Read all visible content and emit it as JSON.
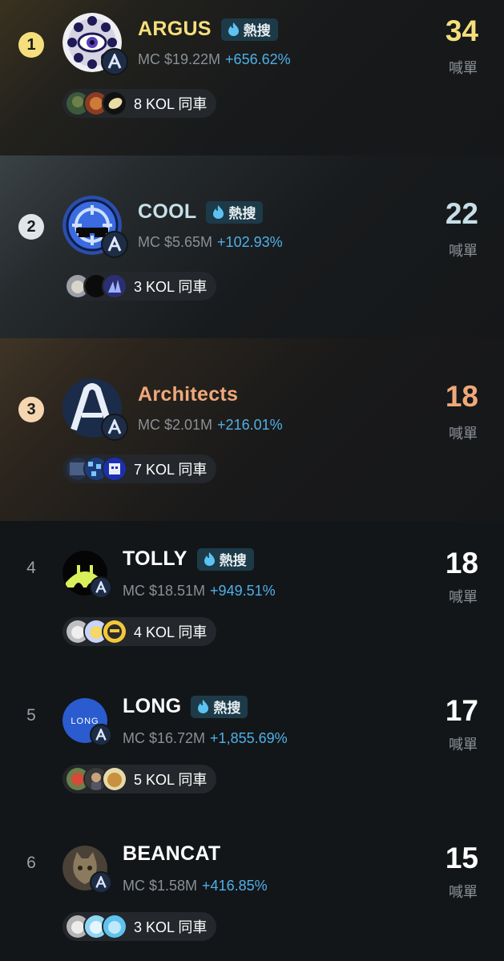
{
  "colors": {
    "gold": "#f5df7c",
    "silver": "#c6dfe7",
    "bronze": "#f0a87a",
    "white": "#ffffff",
    "percent": "#4fb0e8",
    "hot_badge_bg": "#1d3a48"
  },
  "hot_label": "熱搜",
  "count_label": "喊單",
  "rows": [
    {
      "rank": "1",
      "name": "ARGUS",
      "hot": true,
      "mc": "MC $19.22M",
      "pct": "+656.62%",
      "kol": "8 KOL 同車",
      "count": "34",
      "icon": "eye-sphere-icon"
    },
    {
      "rank": "2",
      "name": "COOL",
      "hot": true,
      "mc": "MC $5.65M",
      "pct": "+102.93%",
      "kol": "3 KOL 同車",
      "count": "22",
      "icon": "target-sunglasses-icon"
    },
    {
      "rank": "3",
      "name": "Architects",
      "hot": false,
      "mc": "MC $2.01M",
      "pct": "+216.01%",
      "kol": "7 KOL 同車",
      "count": "18",
      "icon": "arch-a-icon"
    },
    {
      "rank": "4",
      "name": "TOLLY",
      "hot": true,
      "mc": "MC $18.51M",
      "pct": "+949.51%",
      "kol": "4 KOL 同車",
      "count": "18",
      "icon": "bridge-icon"
    },
    {
      "rank": "5",
      "name": "LONG",
      "hot": true,
      "mc": "MC $16.72M",
      "pct": "+1,855.69%",
      "kol": "5 KOL 同車",
      "count": "17",
      "icon": "long-logo-icon"
    },
    {
      "rank": "6",
      "name": "BEANCAT",
      "hot": false,
      "mc": "MC $1.58M",
      "pct": "+416.85%",
      "kol": "3 KOL 同車",
      "count": "15",
      "icon": "cat-photo-icon"
    }
  ]
}
